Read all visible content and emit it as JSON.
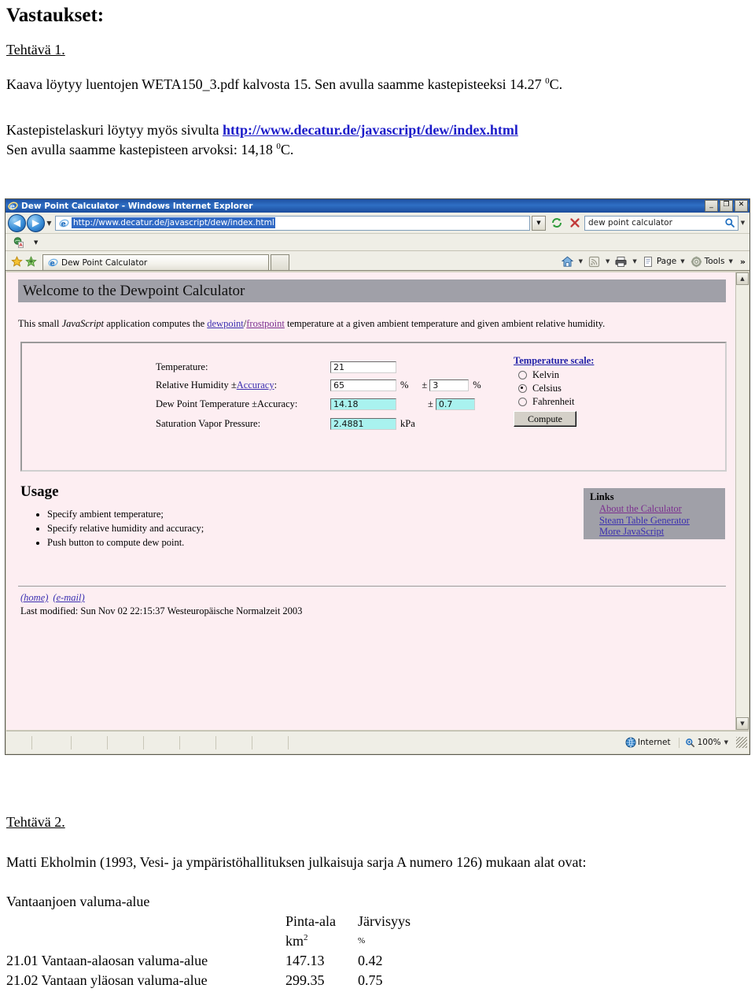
{
  "document": {
    "title": "Vastaukset:",
    "task1": {
      "heading": "Tehtävä 1.",
      "line1_a": "Kaava löytyy luentojen WETA150_3.pdf kalvosta 15. Sen avulla saamme kastepisteeksi 14.27 ",
      "line1_sup": "0",
      "line1_b": "C.",
      "line2_a": "Kastepistelaskuri löytyy myös sivulta ",
      "line2_link": "http://www.decatur.de/javascript/dew/index.html",
      "line3_a": "Sen avulla saamme kastepisteen arvoksi: 14,18 ",
      "line3_sup": "0",
      "line3_b": "C."
    },
    "task2": {
      "heading": "Tehtävä 2.",
      "intro": "Matti Ekholmin (1993, Vesi- ja ympäristöhallituksen julkaisuja sarja A numero 126) mukaan alat ovat:",
      "subtitle": "Vantaanjoen valuma-alue",
      "table": {
        "header_area": "Pinta-ala",
        "header_lake": "Järvisyys",
        "unit_area": "km",
        "unit_area_sup": "2",
        "unit_lake": "%",
        "rows": [
          {
            "name": "21.01 Vantaan-alaosan valuma-alue",
            "area": "147.13",
            "lake": "0.42"
          },
          {
            "name": "21.02  Vantaan yläosan valuma-alue",
            "area": "299.35",
            "lake": "0.75"
          }
        ]
      }
    }
  },
  "browser": {
    "window_title": "Dew Point Calculator - Windows Internet Explorer",
    "window_buttons": {
      "minimize": "_",
      "maximize": "❐",
      "close": "✕"
    },
    "nav": {
      "back": "◀",
      "forward": "▶",
      "history_caret": "▼"
    },
    "address": {
      "url": "http://www.decatur.de/javascript/dew/index.html",
      "dropdown_caret": "▼"
    },
    "refresh_icon": "refresh-icon",
    "stop_icon": "stop-icon",
    "search": {
      "query": "dew point calculator",
      "go_icon": "search-icon",
      "caret": "▼"
    },
    "minibar_caret": "▼",
    "tab": {
      "label": "Dew Point Calculator"
    },
    "commandbar": {
      "home_label": "Home",
      "feeds_label": "Feeds",
      "print_label": "Print",
      "page_label": "Page",
      "tools_label": "Tools",
      "overflow": "»"
    },
    "statusbar": {
      "zone": "Internet",
      "zoom": "100%",
      "zoom_caret": "▼"
    },
    "scrollbar": {
      "up": "▲",
      "down": "▼"
    }
  },
  "webpage": {
    "heading": "Welcome to the Dewpoint Calculator",
    "intro": {
      "a": "This small ",
      "js": "JavaScript",
      "b": " application computes the ",
      "link1": "dewpoint",
      "sep": "/",
      "link2": "frostpoint",
      "c": " temperature at a given ambient temperature and given ambient relative humidity."
    },
    "form": {
      "temperature_label": "Temperature:",
      "temperature_value": "21",
      "humidity_label_a": "Relative Humidity ±",
      "humidity_label_link": "Accuracy",
      "humidity_label_b": ":",
      "humidity_value": "65",
      "humidity_unit": "%",
      "humidity_pm": "±",
      "humidity_acc_value": "3",
      "humidity_acc_unit": "%",
      "dewpoint_label": "Dew Point Temperature ±Accuracy:",
      "dewpoint_value": "14.18",
      "dewpoint_pm": "±",
      "dewpoint_acc_value": "0.7",
      "svp_label": "Saturation Vapor Pressure:",
      "svp_value": "2.4881",
      "svp_unit": "kPa"
    },
    "scale": {
      "title": "Temperature scale:",
      "options": [
        {
          "label": "Kelvin",
          "selected": false
        },
        {
          "label": "Celsius",
          "selected": true
        },
        {
          "label": "Fahrenheit",
          "selected": false
        }
      ],
      "compute_label": "Compute"
    },
    "usage": {
      "heading": "Usage",
      "items": [
        "Specify ambient temperature;",
        "Specify relative humidity and accuracy;",
        "Push button to compute dew point."
      ]
    },
    "links": {
      "title": "Links",
      "items": [
        "About the Calculator",
        "Steam Table Generator",
        "More JavaScript"
      ]
    },
    "footer": {
      "home": "(home)",
      "email": "(e-mail)",
      "last_modified": "Last modified: Sun Nov 02 22:15:37 Westeuropäische Normalzeit 2003"
    }
  },
  "colors": {
    "page_background": "#fdeef2",
    "heading_band": "#a0a0a8",
    "computed_field": "#a9f2ef",
    "link_blue": "#3b2fb0",
    "titlebar_blue": "#1e4fa0"
  }
}
